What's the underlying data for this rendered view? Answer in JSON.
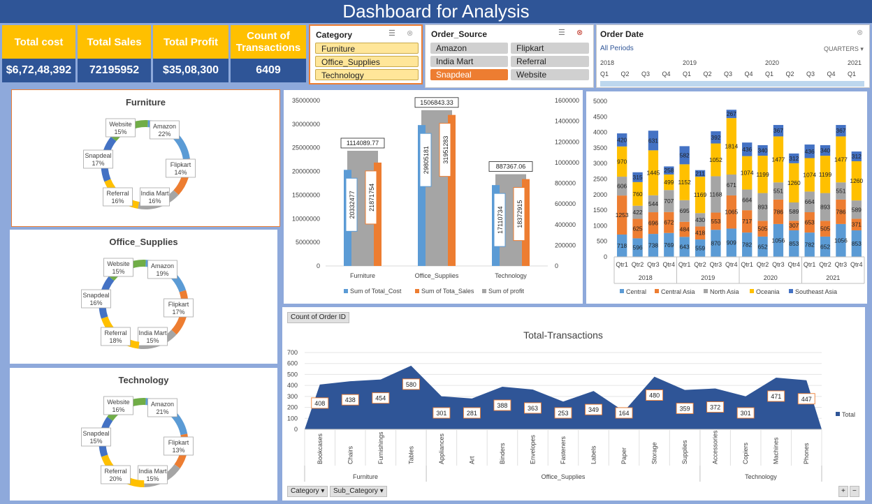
{
  "header": {
    "title": "Dashboard for Analysis"
  },
  "kpis": [
    {
      "label": "Total cost",
      "value": "$6,72,48,392"
    },
    {
      "label": "Total Sales",
      "value": "72195952"
    },
    {
      "label": "Total Profit",
      "value": "$35,08,300"
    },
    {
      "label": "Count of Transactions",
      "value": "6409"
    }
  ],
  "slicer_category": {
    "title": "Category",
    "items": [
      "Furniture",
      "Office_Supplies",
      "Technology"
    ]
  },
  "slicer_source": {
    "title": "Order_Source",
    "items": [
      "Amazon",
      "Flipkart",
      "India Mart",
      "Referral",
      "Snapdeal",
      "Website"
    ],
    "selected": "Snapdeal"
  },
  "timeline": {
    "title": "Order Date",
    "period_label": "All Periods",
    "level": "QUARTERS",
    "years": [
      "2018",
      "2019",
      "2020",
      "2021"
    ],
    "quarters": [
      "Q1",
      "Q2",
      "Q3",
      "Q4",
      "Q1",
      "Q2",
      "Q3",
      "Q4",
      "Q1",
      "Q2",
      "Q3",
      "Q4",
      "Q1"
    ]
  },
  "colors": {
    "blue": "#5b9bd5",
    "orange": "#ed7d31",
    "gray": "#a5a5a5",
    "yellow": "#ffc000",
    "dark_blue": "#4472c4",
    "green": "#70ad47",
    "navy": "#2f5597"
  },
  "chart_data": [
    {
      "type": "pie",
      "title": "Furniture",
      "slices": [
        {
          "label": "Amazon",
          "value": 22
        },
        {
          "label": "Flipkart",
          "value": 14
        },
        {
          "label": "India Mart",
          "value": 16
        },
        {
          "label": "Referral",
          "value": 16
        },
        {
          "label": "Snapdeal",
          "value": 17
        },
        {
          "label": "Website",
          "value": 15
        }
      ]
    },
    {
      "type": "pie",
      "title": "Office_Supplies",
      "slices": [
        {
          "label": "Amazon",
          "value": 19
        },
        {
          "label": "Flipkart",
          "value": 17
        },
        {
          "label": "India Mart",
          "value": 15
        },
        {
          "label": "Referral",
          "value": 18
        },
        {
          "label": "Snapdeal",
          "value": 16
        },
        {
          "label": "Website",
          "value": 15
        }
      ]
    },
    {
      "type": "pie",
      "title": "Technology",
      "slices": [
        {
          "label": "Amazon",
          "value": 21
        },
        {
          "label": "Flipkart",
          "value": 13
        },
        {
          "label": "India Mart",
          "value": 15
        },
        {
          "label": "Referral",
          "value": 20
        },
        {
          "label": "Snapdeal",
          "value": 15
        },
        {
          "label": "Website",
          "value": 16
        }
      ]
    },
    {
      "type": "bar",
      "categories": [
        "Furniture",
        "Office_Supplies",
        "Technology"
      ],
      "series": [
        {
          "name": "Sum of Total_Cost",
          "values": [
            20332477,
            29805181,
            17110734
          ],
          "axis": "left"
        },
        {
          "name": "Sum of Tota_Sales",
          "values": [
            21871754,
            31951283,
            18372915
          ],
          "axis": "left"
        },
        {
          "name": "Sum of profit",
          "values": [
            1114089.77,
            1506843.33,
            887367.06
          ],
          "axis": "right"
        }
      ],
      "ylim": [
        0,
        35000000
      ],
      "yticks": [
        "0",
        "5000000",
        "10000000",
        "15000000",
        "20000000",
        "25000000",
        "30000000",
        "35000000"
      ],
      "y2lim": [
        0,
        1600000
      ],
      "y2ticks": [
        "0",
        "200000",
        "400000",
        "600000",
        "800000",
        "1000000",
        "1200000",
        "1400000",
        "1600000"
      ],
      "profit_labels": [
        "1114089.77",
        "1506843.33",
        "887367.06"
      ]
    },
    {
      "type": "bar",
      "stacked": true,
      "categories": [
        "Qtr1",
        "Qtr2",
        "Qtr3",
        "Qtr4",
        "Qtr1",
        "Qtr2",
        "Qtr3",
        "Qtr4",
        "Qtr1",
        "Qtr2",
        "Qtr3",
        "Qtr4",
        "Qtr1",
        "Qtr2",
        "Qtr3",
        "Qtr4"
      ],
      "groups": [
        "2018",
        "2019",
        "2020",
        "2021"
      ],
      "series": [
        {
          "name": "Central",
          "values": [
            718,
            596,
            738,
            769,
            643,
            559,
            870,
            909,
            782,
            652,
            1056,
            853,
            782,
            652,
            1056,
            853
          ]
        },
        {
          "name": "Central Asia",
          "values": [
            1253,
            625,
            696,
            672,
            484,
            418,
            553,
            1065,
            717,
            505,
            786,
            307,
            653,
            505,
            786,
            371
          ]
        },
        {
          "name": "North Asia",
          "values": [
            606,
            422,
            544,
            707,
            695,
            430,
            1168,
            671,
            664,
            893,
            551,
            589,
            664,
            893,
            551,
            589
          ]
        },
        {
          "name": "Oceania",
          "values": [
            970,
            760,
            1445,
            499,
            1152,
            1169,
            1052,
            1814,
            1074,
            1199,
            1477,
            1260,
            1074,
            1199,
            1477,
            1260
          ]
        },
        {
          "name": "Southeast Asia",
          "values": [
            420,
            315,
            631,
            258,
            582,
            211,
            392,
            267,
            436,
            340,
            367,
            312,
            436,
            340,
            367,
            312
          ]
        }
      ],
      "ylim": [
        0,
        5000
      ],
      "yticks": [
        "0",
        "500",
        "1000",
        "1500",
        "2000",
        "2500",
        "3000",
        "3500",
        "4000",
        "4500",
        "5000"
      ]
    },
    {
      "type": "area",
      "title": "Total-Transactions",
      "field_button": "Count of Order ID",
      "categories": [
        "Bookcases",
        "Chairs",
        "Furnishings",
        "Tables",
        "Appliances",
        "Art",
        "Binders",
        "Envelopes",
        "Fasteners",
        "Labels",
        "Paper",
        "Storage",
        "Supplies",
        "Accessories",
        "Copiers",
        "Machines",
        "Phones"
      ],
      "groups": [
        {
          "name": "Furniture",
          "count": 4
        },
        {
          "name": "Office_Supplies",
          "count": 9
        },
        {
          "name": "Technology",
          "count": 4
        }
      ],
      "series": [
        {
          "name": "Total",
          "values": [
            408,
            438,
            454,
            580,
            301,
            281,
            388,
            363,
            253,
            349,
            164,
            480,
            359,
            372,
            301,
            471,
            447
          ]
        }
      ],
      "ylim": [
        0,
        700
      ],
      "yticks": [
        "0",
        "100",
        "200",
        "300",
        "400",
        "500",
        "600",
        "700"
      ],
      "filter_buttons": [
        "Category",
        "Sub_Category"
      ]
    }
  ]
}
